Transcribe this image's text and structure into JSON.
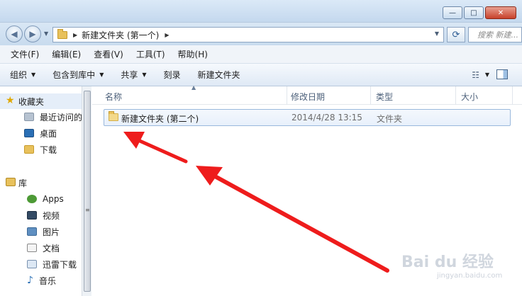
{
  "window": {
    "controls": {
      "minimize": "—",
      "maximize": "□",
      "close": "✕"
    }
  },
  "address": {
    "crumb": "新建文件夹 (第一个)",
    "search_placeholder": "搜索 新建..."
  },
  "menu": [
    "文件(F)",
    "编辑(E)",
    "查看(V)",
    "工具(T)",
    "帮助(H)"
  ],
  "commands": {
    "organize": "组织",
    "include_library": "包含到库中",
    "share": "共享",
    "burn": "刻录",
    "new_folder": "新建文件夹"
  },
  "sidebar": {
    "favorites": "收藏夹",
    "recent": "最近访问的",
    "desktop": "桌面",
    "downloads": "下载",
    "libraries": "库",
    "apps": "Apps",
    "videos": "视频",
    "pictures": "图片",
    "documents": "文档",
    "thunder": "迅雷下载",
    "music": "音乐"
  },
  "columns": {
    "name": "名称",
    "modified": "修改日期",
    "type": "类型",
    "size": "大小"
  },
  "files": [
    {
      "name": "新建文件夹 (第二个)",
      "modified": "2014/4/28 13:15",
      "type": "文件夹",
      "size": ""
    }
  ],
  "watermark": {
    "brand": "Bai du 经验",
    "url": "jingyan.baidu.com"
  },
  "colors": {
    "annotation_arrow": "#ee1c1c",
    "selection": "#e8f0fb"
  }
}
